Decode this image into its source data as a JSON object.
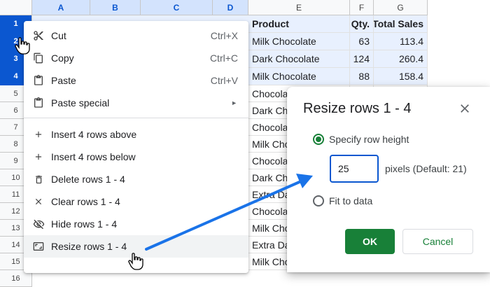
{
  "sheet": {
    "columns": [
      "A",
      "B",
      "C",
      "D",
      "E",
      "F",
      "G"
    ],
    "rows": [
      "1",
      "2",
      "3",
      "4",
      "5",
      "6",
      "7",
      "8",
      "9",
      "10",
      "11",
      "12",
      "13",
      "14",
      "15",
      "16"
    ],
    "selected_rows": [
      "1",
      "2",
      "3",
      "4"
    ],
    "header": {
      "product": "Product",
      "qty": "Qty.",
      "total": "Total Sales"
    },
    "data": [
      {
        "product": "Milk Chocolate",
        "qty": "63",
        "total": "113.4"
      },
      {
        "product": "Dark Chocolate",
        "qty": "124",
        "total": "260.4"
      },
      {
        "product": "Milk Chocolate",
        "qty": "88",
        "total": "158.4"
      },
      {
        "product": "Chocolate",
        "qty": "",
        "total": ""
      },
      {
        "product": "Dark Chocolate",
        "qty": "",
        "total": ""
      },
      {
        "product": "Chocolate",
        "qty": "",
        "total": ""
      },
      {
        "product": "Milk Chocolate",
        "qty": "",
        "total": ""
      },
      {
        "product": "Chocolate",
        "qty": "",
        "total": ""
      },
      {
        "product": "Dark Chocolate",
        "qty": "",
        "total": ""
      },
      {
        "product": "Extra Dark",
        "qty": "",
        "total": ""
      },
      {
        "product": "Chocolate",
        "qty": "",
        "total": ""
      },
      {
        "product": "Milk Chocolate",
        "qty": "",
        "total": ""
      },
      {
        "product": "Extra Dark",
        "qty": "",
        "total": ""
      },
      {
        "product": "Milk Chocolate",
        "qty": "",
        "total": ""
      }
    ]
  },
  "context_menu": {
    "cut": {
      "label": "Cut",
      "shortcut": "Ctrl+X"
    },
    "copy": {
      "label": "Copy",
      "shortcut": "Ctrl+C"
    },
    "paste": {
      "label": "Paste",
      "shortcut": "Ctrl+V"
    },
    "paste_special": {
      "label": "Paste special"
    },
    "insert_above": {
      "label": "Insert 4 rows above"
    },
    "insert_below": {
      "label": "Insert 4 rows below"
    },
    "delete_rows": {
      "label": "Delete rows 1 - 4"
    },
    "clear_rows": {
      "label": "Clear rows 1 - 4"
    },
    "hide_rows": {
      "label": "Hide rows 1 - 4"
    },
    "resize_rows": {
      "label": "Resize rows 1 - 4"
    }
  },
  "dialog": {
    "title": "Resize rows 1 - 4",
    "option_specify": "Specify row height",
    "height_value": "25",
    "pixels_label": "pixels (Default: 21)",
    "option_fit": "Fit to data",
    "ok_label": "OK",
    "cancel_label": "Cancel"
  },
  "colors": {
    "accent_blue": "#0b57d0",
    "selection_fill": "#e8f0fe",
    "ok_green": "#188038",
    "arrow_blue": "#1a73e8"
  }
}
